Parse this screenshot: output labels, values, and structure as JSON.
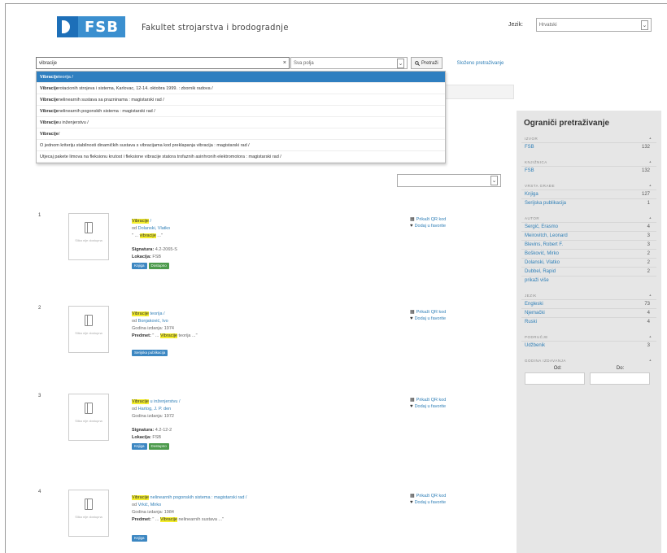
{
  "header": {
    "logo_text": "FSB",
    "faculty_name": "Fakultet strojarstva i brodogradnje",
    "language_label": "Jezik:",
    "language_value": "Hrvatski"
  },
  "search": {
    "query": "vibracije",
    "clear_symbol": "×",
    "scope_value": "Sva polja",
    "button_label": "Pretraži",
    "advanced_link": "Složeno pretraživanje"
  },
  "suggestions": [
    {
      "bold": "Vibracije",
      "rest": " teorija /"
    },
    {
      "bold": "Vibracije",
      "rest": " rotacionih strojeva i sistema, Karlovac, 12-14. oktobra 1999. : zbornik radova /"
    },
    {
      "bold": "Vibracije",
      "rest": " nelinearnih sustava sa prazninama : magistarski rad /"
    },
    {
      "bold": "Vibracije",
      "rest": " nelinearnih pogonskih sistema : magistarski rad /"
    },
    {
      "bold": "Vibracije",
      "rest": " u inženjerstvu /"
    },
    {
      "bold": "Vibracije",
      "rest": " /"
    },
    {
      "bold": "",
      "rest": "O jednom kriteriju stabilnosti dinamičkih sustava s vibracijama kod preklapanja vibracija : magistarski rad /"
    },
    {
      "bold": "",
      "rest": "Utjecaj pakete limova na fleksionu krutost i fleksione vibracije statora trofaznih asinhronih elektromotora : magistarski rad /"
    }
  ],
  "results": [
    {
      "num": "1",
      "thumb_text": "Slika nije dostupna",
      "title_hl": "Vibracije",
      "title_rest": " /",
      "author_prefix": "od ",
      "author": "Dolanski, Vlatko",
      "snippet_pre": "\" ... ",
      "snippet_hl": "vibracije",
      "snippet_post": " ...\"",
      "lines": [
        {
          "label": "Signatura:",
          "value": " 4.2-2065-S"
        },
        {
          "label": "Lokacija:",
          "value": " FSB"
        }
      ],
      "tags": [
        {
          "text": "Knjiga",
          "color": "blue"
        },
        {
          "text": "Dostupno",
          "color": "green"
        }
      ],
      "action_qr": "Prikaži QR kod",
      "action_fav": "Dodaj u favorite"
    },
    {
      "num": "2",
      "thumb_text": "Slika nije dostupna",
      "title_hl": "Vibracije",
      "title_rest": " teorija /",
      "author_prefix": "od ",
      "author": "Bonjaković, Ivo",
      "plain_line": "Godina izdanja: 1974",
      "subject_label": "Predmet:",
      "subject_pre": " \" ... ",
      "subject_hl": "Vibracije",
      "subject_post": " teorija ...\"",
      "tags": [
        {
          "text": "Serijska publikacija",
          "color": "blue"
        }
      ],
      "action_qr": "Prikaži QR kod",
      "action_fav": "Dodaj u favorite"
    },
    {
      "num": "3",
      "thumb_text": "Slika nije dostupna",
      "title_hl": "Vibracije",
      "title_rest": " u inženjerstvu /",
      "author_prefix": "od ",
      "author": "Hartog, J. P. den",
      "plain_line": "Godina izdanja: 1972",
      "lines": [
        {
          "label": "Signatura:",
          "value": " 4.2-12-2"
        },
        {
          "label": "Lokacija:",
          "value": " FSB"
        }
      ],
      "tags": [
        {
          "text": "Knjiga",
          "color": "blue"
        },
        {
          "text": "Dostupno",
          "color": "green"
        }
      ],
      "action_qr": "Prikaži QR kod",
      "action_fav": "Dodaj u favorite"
    },
    {
      "num": "4",
      "thumb_text": "Slika nije dostupna",
      "title_hl": "Vibracije",
      "title_rest": " nelinearnih pogonskih sistema : magistarski rad /",
      "author_prefix": "od ",
      "author": "Vrkić, Mirko",
      "plain_line": "Godina izdanja: 1984",
      "subject_label": "Predmet:",
      "subject_pre": " \" ... ",
      "subject_hl": "Vibracije",
      "subject_post": " nelinearnih sustava ...\"",
      "tags": [
        {
          "text": "Knjiga",
          "color": "blue"
        }
      ],
      "action_qr": "Prikaži QR kod",
      "action_fav": "Dodaj u favorite"
    }
  ],
  "sidebar": {
    "title": "Ograniči pretraživanje",
    "facets": [
      {
        "head": "IZVOR",
        "items": [
          {
            "label": "FSB",
            "count": "132"
          }
        ]
      },
      {
        "head": "KNJIŽNICA",
        "items": [
          {
            "label": "FSB",
            "count": "132"
          }
        ]
      },
      {
        "head": "VRSTA GRAĐE",
        "items": [
          {
            "label": "Knjiga",
            "count": "127"
          },
          {
            "label": "Serijska publikacija",
            "count": "1"
          }
        ]
      },
      {
        "head": "AUTOR",
        "items": [
          {
            "label": "Sergić, Erasmo",
            "count": "4"
          },
          {
            "label": "Meirovitch, Leonard",
            "count": "3"
          },
          {
            "label": "Blevins, Robert F.",
            "count": "3"
          },
          {
            "label": "Bošković, Mirko",
            "count": "2"
          },
          {
            "label": "Dolanski, Vlatko",
            "count": "2"
          },
          {
            "label": "Dubbel, Rapid",
            "count": "2"
          },
          {
            "label": "prikaži više",
            "count": ""
          }
        ]
      },
      {
        "head": "JEZIK",
        "items": [
          {
            "label": "Engleski",
            "count": "73"
          },
          {
            "label": "Njemački",
            "count": "4"
          },
          {
            "label": "Ruski",
            "count": "4"
          }
        ]
      },
      {
        "head": "PODRUČJE",
        "items": [
          {
            "label": "Udžbenik",
            "count": "3"
          }
        ]
      },
      {
        "head": "GODINA IZDAVANJA",
        "items": []
      }
    ],
    "date_from": "Od:",
    "date_to": "Do:"
  },
  "colors": {
    "accent": "#2f7fb7",
    "highlight": "#f4ee2b",
    "logo": "#3b8fcf"
  }
}
